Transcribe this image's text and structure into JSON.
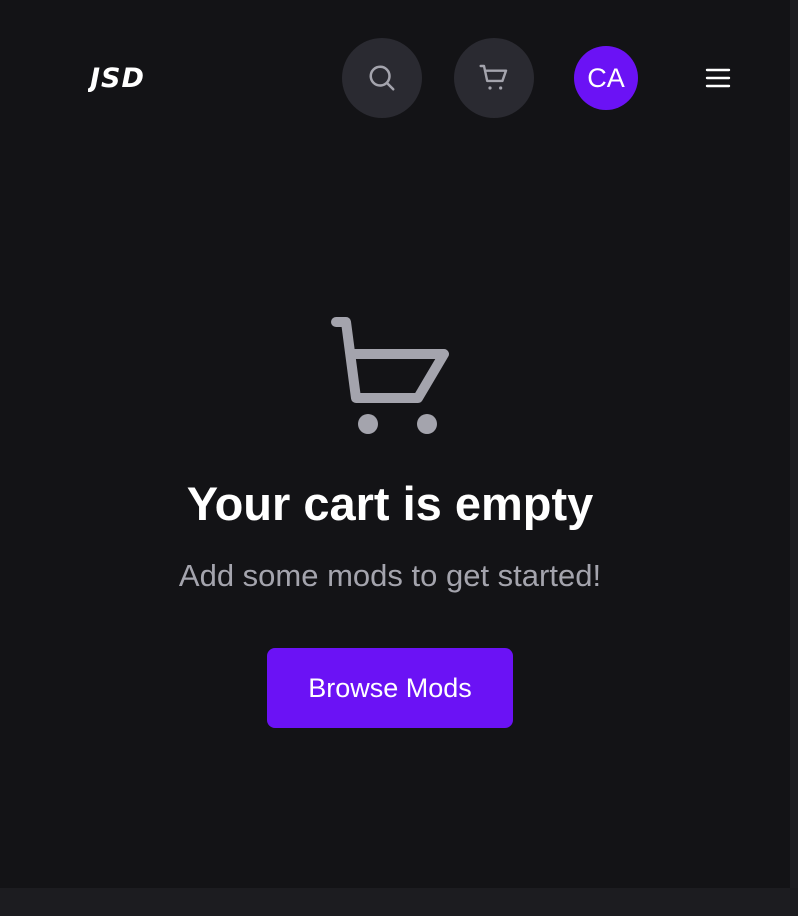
{
  "header": {
    "logo_text": "JSD",
    "search_icon": "search-icon",
    "cart_icon": "cart-icon",
    "avatar_initials": "CA",
    "menu_icon": "hamburger-menu-icon"
  },
  "empty_state": {
    "icon": "cart-icon",
    "title": "Your cart is empty",
    "subtitle": "Add some mods to get started!",
    "button_label": "Browse Mods"
  },
  "colors": {
    "background": "#131316",
    "accent": "#6b12f5",
    "icon_button_bg": "#2a2a31",
    "muted_text": "#a4a4ad"
  }
}
